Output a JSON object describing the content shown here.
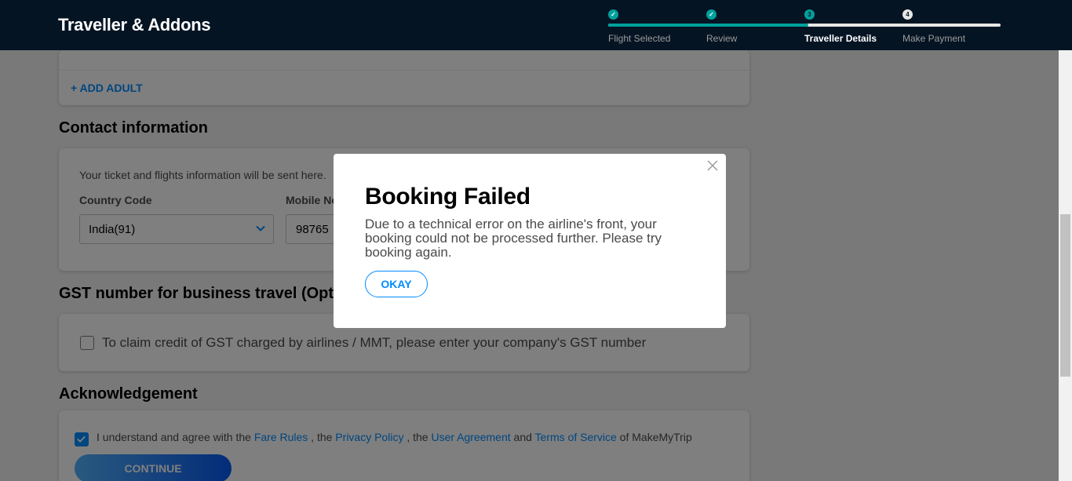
{
  "header": {
    "title": "Traveller & Addons",
    "steps": [
      {
        "label": "Flight Selected",
        "marker": "✓",
        "state": "done"
      },
      {
        "label": "Review",
        "marker": "✓",
        "state": "done"
      },
      {
        "label": "Traveller Details",
        "marker": "3",
        "state": "current"
      },
      {
        "label": "Make Payment",
        "marker": "4",
        "state": "todo"
      }
    ],
    "progress_fraction": 0.51
  },
  "travellers": {
    "add_adult_label": "+ ADD ADULT"
  },
  "contact": {
    "title": "Contact information",
    "note": "Your ticket and flights information will be sent here.",
    "country_code_label": "Country Code",
    "country_code_value": "India(91)",
    "mobile_label": "Mobile No",
    "mobile_value": "98765"
  },
  "gst": {
    "title": "GST number for business travel (Optional)",
    "checkbox_label": "To claim credit of GST charged by airlines / MMT, please enter your company's GST number"
  },
  "acknowledgement": {
    "title": "Acknowledgement",
    "text_1": "I understand and agree with the ",
    "fare_rules": "Fare Rules",
    "text_2": " , the ",
    "privacy_policy": "Privacy Policy",
    "text_3": " , the ",
    "user_agreement": "User Agreement",
    "text_4": " and ",
    "terms_of_service": "Terms of Service",
    "text_5": " of MakeMyTrip",
    "checked": true
  },
  "continue_label": "CONTINUE",
  "modal": {
    "title": "Booking Failed",
    "message": "Due to a technical error on the airline's front, your booking could not be processed further. Please try booking again.",
    "okay_label": "OKAY"
  },
  "colors": {
    "header_bg": "#051423",
    "accent_blue": "#008cff",
    "progress": "#00a19c"
  }
}
